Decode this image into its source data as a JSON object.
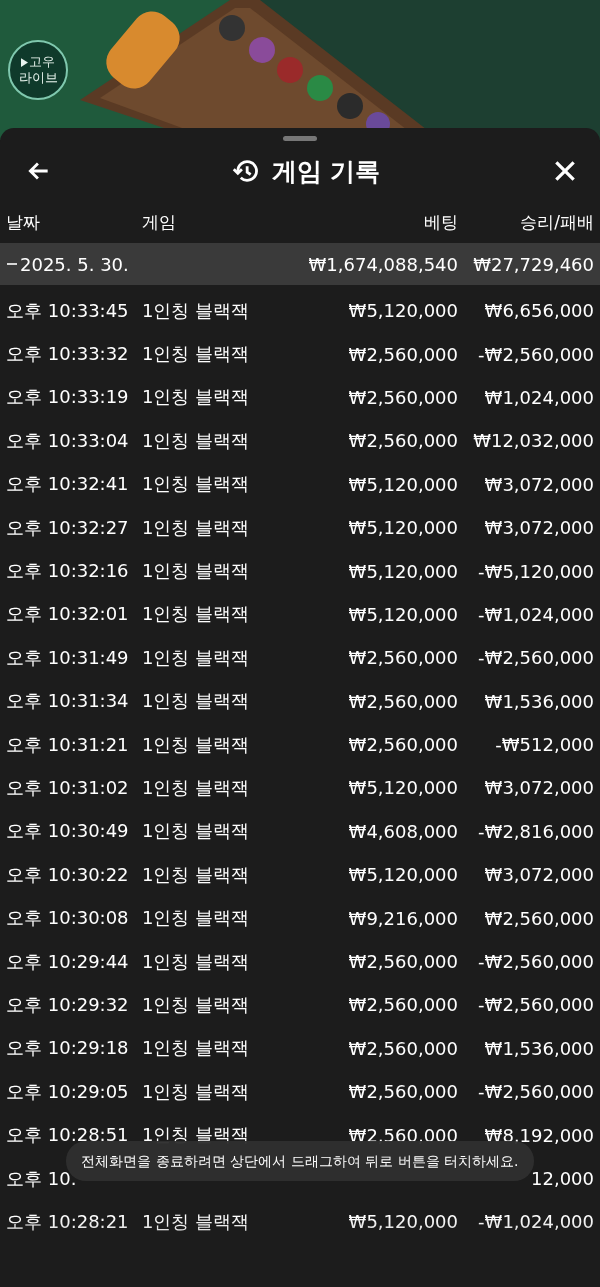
{
  "logo": {
    "line_1": "고우",
    "line_2": "라이브"
  },
  "header": {
    "title": "게임 기록"
  },
  "columns": [
    "날짜",
    "게임",
    "베팅",
    "승리/패배"
  ],
  "summary": {
    "date": "2025. 5. 30.",
    "bet": "₩1,674,088,540",
    "result": "₩27,729,460",
    "expanded": true
  },
  "rows": [
    {
      "time": "오후 10:33:45",
      "game": "1인칭 블랙잭",
      "bet": "₩5,120,000",
      "result": "₩6,656,000"
    },
    {
      "time": "오후 10:33:32",
      "game": "1인칭 블랙잭",
      "bet": "₩2,560,000",
      "result": "-₩2,560,000"
    },
    {
      "time": "오후 10:33:19",
      "game": "1인칭 블랙잭",
      "bet": "₩2,560,000",
      "result": "₩1,024,000"
    },
    {
      "time": "오후 10:33:04",
      "game": "1인칭 블랙잭",
      "bet": "₩2,560,000",
      "result": "₩12,032,000"
    },
    {
      "time": "오후 10:32:41",
      "game": "1인칭 블랙잭",
      "bet": "₩5,120,000",
      "result": "₩3,072,000"
    },
    {
      "time": "오후 10:32:27",
      "game": "1인칭 블랙잭",
      "bet": "₩5,120,000",
      "result": "₩3,072,000"
    },
    {
      "time": "오후 10:32:16",
      "game": "1인칭 블랙잭",
      "bet": "₩5,120,000",
      "result": "-₩5,120,000"
    },
    {
      "time": "오후 10:32:01",
      "game": "1인칭 블랙잭",
      "bet": "₩5,120,000",
      "result": "-₩1,024,000"
    },
    {
      "time": "오후 10:31:49",
      "game": "1인칭 블랙잭",
      "bet": "₩2,560,000",
      "result": "-₩2,560,000"
    },
    {
      "time": "오후 10:31:34",
      "game": "1인칭 블랙잭",
      "bet": "₩2,560,000",
      "result": "₩1,536,000"
    },
    {
      "time": "오후 10:31:21",
      "game": "1인칭 블랙잭",
      "bet": "₩2,560,000",
      "result": "-₩512,000"
    },
    {
      "time": "오후 10:31:02",
      "game": "1인칭 블랙잭",
      "bet": "₩5,120,000",
      "result": "₩3,072,000"
    },
    {
      "time": "오후 10:30:49",
      "game": "1인칭 블랙잭",
      "bet": "₩4,608,000",
      "result": "-₩2,816,000"
    },
    {
      "time": "오후 10:30:22",
      "game": "1인칭 블랙잭",
      "bet": "₩5,120,000",
      "result": "₩3,072,000"
    },
    {
      "time": "오후 10:30:08",
      "game": "1인칭 블랙잭",
      "bet": "₩9,216,000",
      "result": "₩2,560,000"
    },
    {
      "time": "오후 10:29:44",
      "game": "1인칭 블랙잭",
      "bet": "₩2,560,000",
      "result": "-₩2,560,000"
    },
    {
      "time": "오후 10:29:32",
      "game": "1인칭 블랙잭",
      "bet": "₩2,560,000",
      "result": "-₩2,560,000"
    },
    {
      "time": "오후 10:29:18",
      "game": "1인칭 블랙잭",
      "bet": "₩2,560,000",
      "result": "₩1,536,000"
    },
    {
      "time": "오후 10:29:05",
      "game": "1인칭 블랙잭",
      "bet": "₩2,560,000",
      "result": "-₩2,560,000"
    },
    {
      "time": "오후 10:28:51",
      "game": "1인칭 블랙잭",
      "bet": "₩2,560,000",
      "result": "₩8,192,000"
    },
    {
      "time": "오후 10.",
      "result": "12,000"
    },
    {
      "time": "오후 10:28:21",
      "game": "1인칭 블랙잭",
      "bet": "₩5,120,000",
      "result": "-₩1,024,000"
    }
  ],
  "toast": "전체화면을 종료하려면 상단에서 드래그하여 뒤로 버튼을 터치하세요."
}
